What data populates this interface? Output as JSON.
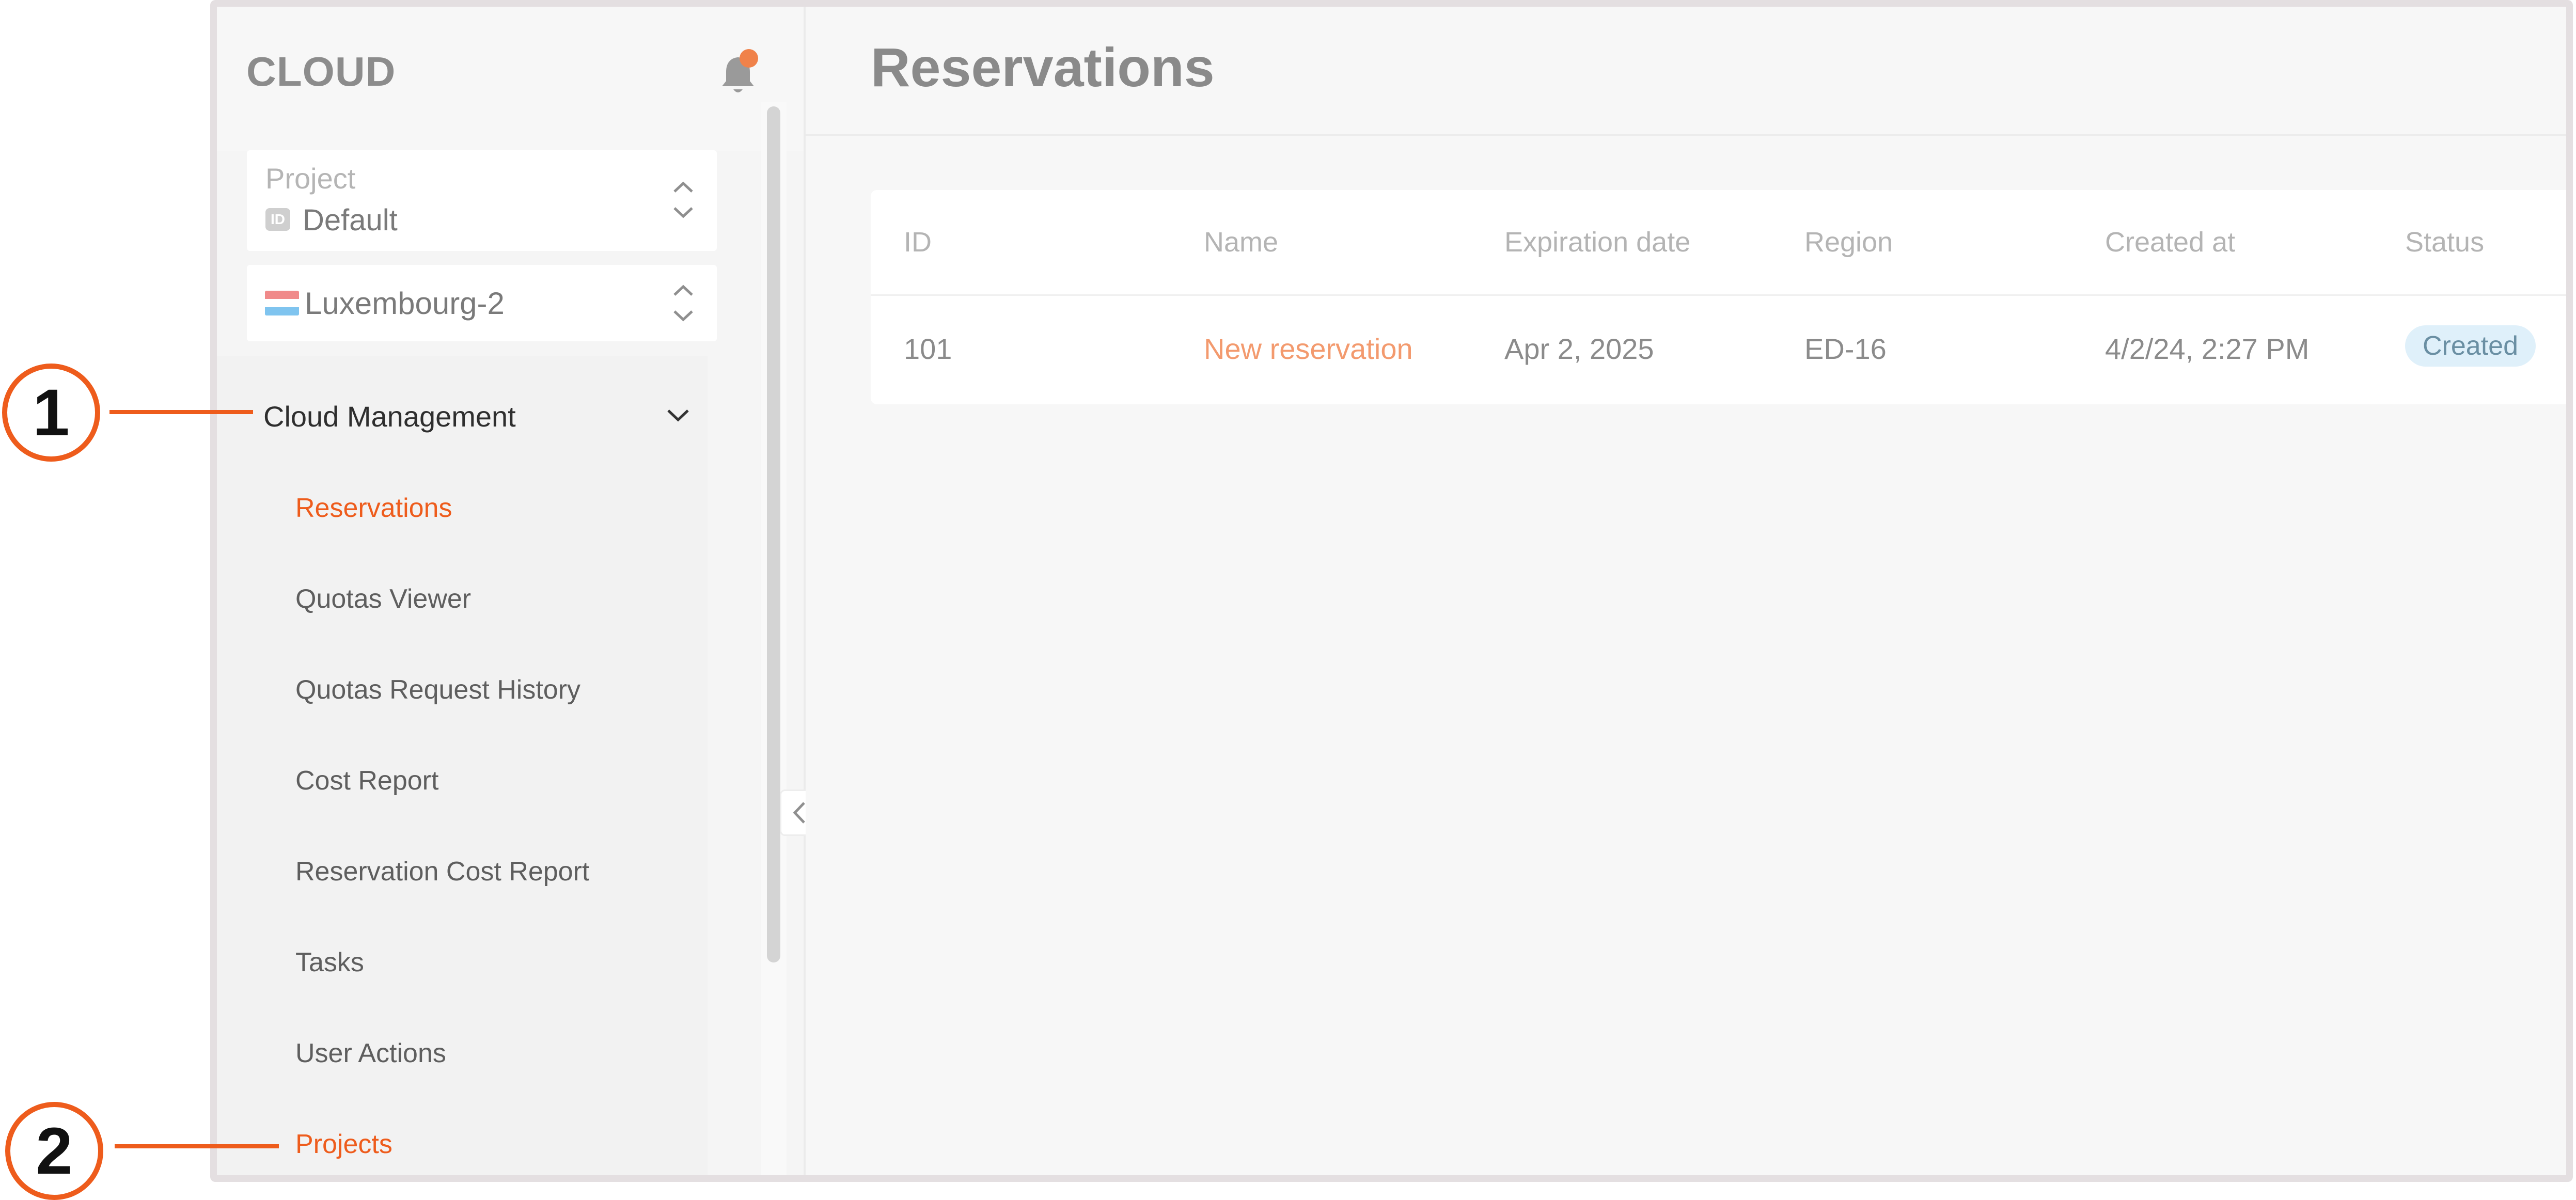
{
  "app": {
    "logo": "CLOUD"
  },
  "project_selector": {
    "label": "Project",
    "badge": "ID",
    "value": "Default"
  },
  "region_selector": {
    "value": "Luxembourg-2"
  },
  "sidebar": {
    "group": "Cloud Management",
    "items": [
      {
        "label": "Reservations",
        "active": true
      },
      {
        "label": "Quotas Viewer",
        "active": false
      },
      {
        "label": "Quotas Request History",
        "active": false
      },
      {
        "label": "Cost Report",
        "active": false
      },
      {
        "label": "Reservation Cost Report",
        "active": false
      },
      {
        "label": "Tasks",
        "active": false
      },
      {
        "label": "User Actions",
        "active": false
      },
      {
        "label": "Projects",
        "active": true
      }
    ]
  },
  "main": {
    "title": "Reservations",
    "table": {
      "columns": [
        "ID",
        "Name",
        "Expiration date",
        "Region",
        "Created at",
        "Status"
      ],
      "rows": [
        {
          "id": "101",
          "name": "New reservation",
          "expiration": "Apr 2, 2025",
          "region": "ED-16",
          "created": "4/2/24, 2:27 PM",
          "status": "Created"
        }
      ]
    }
  },
  "callouts": [
    "1",
    "2"
  ],
  "colors": {
    "accent": "#ee5c1c",
    "notification_dot": "#f0824a",
    "status_bg": "#dff0fa"
  },
  "icons": [
    "bell-icon",
    "chevron-up-icon",
    "chevron-down-icon",
    "flag-icon",
    "chevron-left-icon"
  ]
}
